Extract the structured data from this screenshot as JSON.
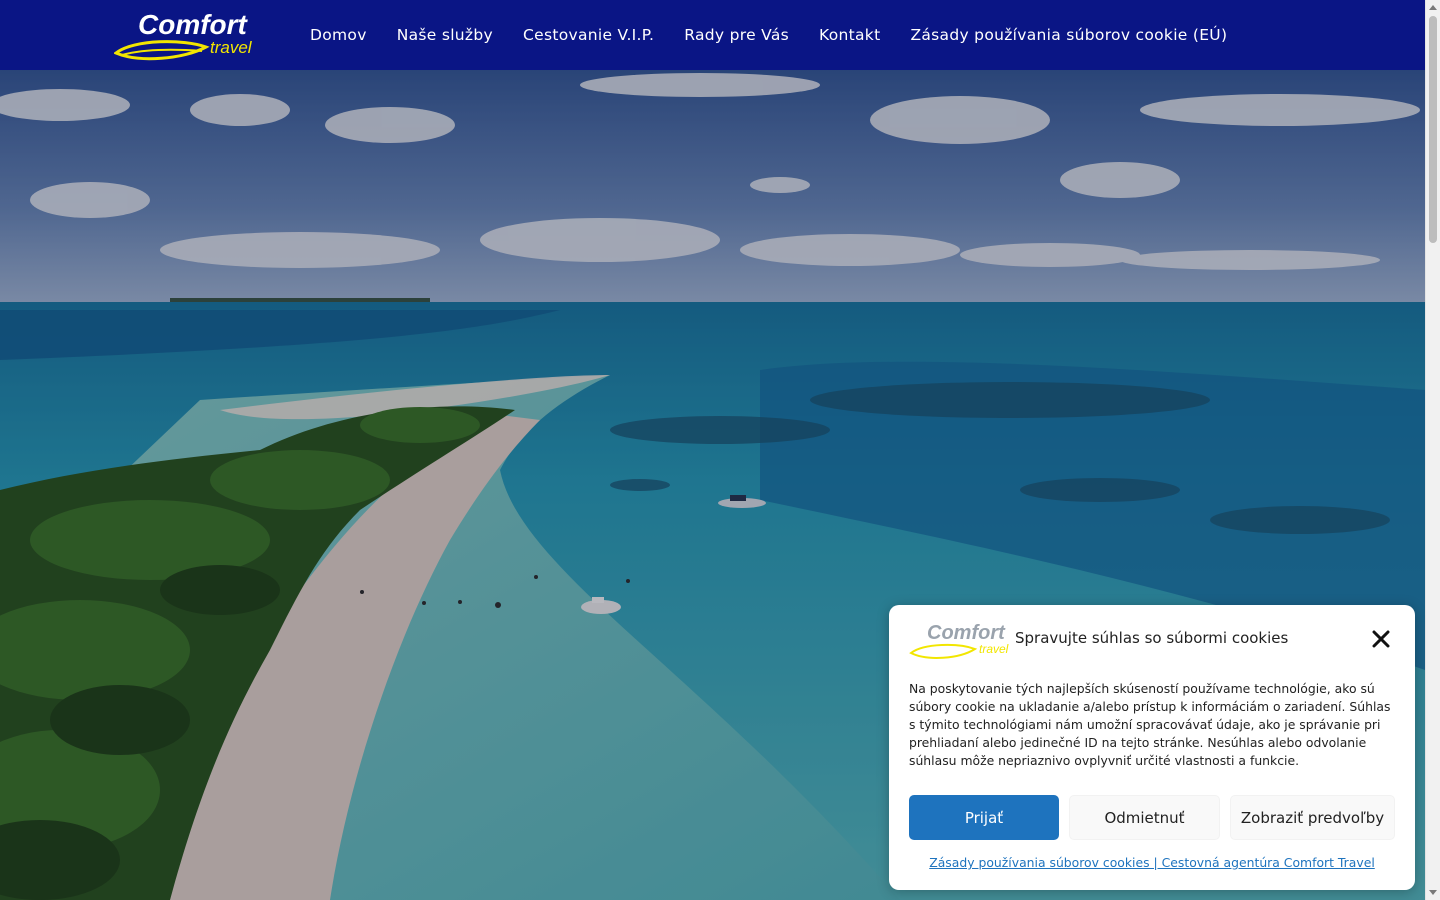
{
  "brand": {
    "logo_word": "Comfort",
    "logo_sub": "travel",
    "colors": {
      "header_bg": "#0a1585",
      "logo_text": "#ffffff",
      "logo_accent": "#f2e600",
      "button_primary": "#1e73be"
    }
  },
  "nav": {
    "items": [
      {
        "label": "Domov"
      },
      {
        "label": "Naše služby"
      },
      {
        "label": "Cestovanie V.I.P."
      },
      {
        "label": "Rady pre Vás"
      },
      {
        "label": "Kontakt"
      },
      {
        "label": "Zásady používania súborov cookie (EÚ)"
      }
    ]
  },
  "cookie_banner": {
    "title": "Spravujte súhlas so súbormi cookies",
    "body": "Na poskytovanie tých najlepších skúseností používame technológie, ako sú súbory cookie na ukladanie a/alebo prístup k informáciám o zariadení. Súhlas s týmito technológiami nám umožní spracovávať údaje, ako je správanie pri prehliadaní alebo jedinečné ID na tejto stránke. Nesúhlas alebo odvolanie súhlasu môže nepriaznivo ovplyvniť určité vlastnosti a funkcie.",
    "accept_label": "Prijať",
    "deny_label": "Odmietnuť",
    "prefs_label": "Zobraziť predvoľby",
    "policy_link": "Zásady používania súborov cookies | Cestovná agentúra Comfort Travel",
    "close_icon": "close-icon"
  }
}
